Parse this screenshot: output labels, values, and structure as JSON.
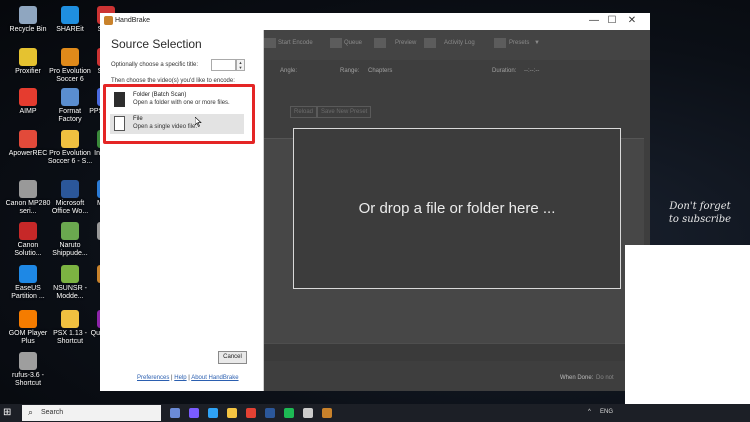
{
  "desktop_icons": [
    {
      "label": "Recycle Bin",
      "color": "#8fa6c0"
    },
    {
      "label": "SHAREit",
      "color": "#1f8fe0"
    },
    {
      "label": "Strea",
      "color": "#c33"
    },
    {
      "label": "Proxifier",
      "color": "#e5c230"
    },
    {
      "label": "Pro Evolution Soccer 6",
      "color": "#e08a1a"
    },
    {
      "label": "Strea",
      "color": "#c33"
    },
    {
      "label": "AIMP",
      "color": "#e53c2f"
    },
    {
      "label": "Format Factory",
      "color": "#5a8ed0"
    },
    {
      "label": "PPSS - Sh",
      "color": "#4a6ae0"
    },
    {
      "label": "ApowerREC",
      "color": "#e24a3a"
    },
    {
      "label": "Pro Evolution Soccer 6 - S...",
      "color": "#f0c040"
    },
    {
      "label": "Int Dow",
      "color": "#3a8a3a"
    },
    {
      "label": "Canon MP280 seri...",
      "color": "#999999"
    },
    {
      "label": "Microsoft Office Wo...",
      "color": "#2b579a"
    },
    {
      "label": "Mi Ed",
      "color": "#2b7bd6"
    },
    {
      "label": "Canon Solutio...",
      "color": "#c62828"
    },
    {
      "label": "Naruto Shippude...",
      "color": "#6aa84f"
    },
    {
      "label": "SM",
      "color": "#999999"
    },
    {
      "label": "EaseUS Partition ...",
      "color": "#1e88e5"
    },
    {
      "label": "NSUNSR - Modde...",
      "color": "#7cb342"
    },
    {
      "label": "Han",
      "color": "#c9822b"
    },
    {
      "label": "GOM Player Plus",
      "color": "#f57c00"
    },
    {
      "label": "PSX 1.13 - Shortcut",
      "color": "#f0c040"
    },
    {
      "label": "Quick Net",
      "color": "#8e24aa"
    },
    {
      "label": "rufus-3.6 - Shortcut",
      "color": "#9e9e9e"
    }
  ],
  "watermark": {
    "line1": "Don't forget",
    "line2": "to subscribe"
  },
  "window": {
    "title": "HandBrake",
    "minimize": "—",
    "maximize": "☐",
    "close": "✕"
  },
  "toolbar": {
    "start_encode": "Start Encode",
    "queue": "Queue",
    "preview": "Preview",
    "activity_log": "Activity Log",
    "presets": "Presets"
  },
  "source_row": {
    "angle": "Angle:",
    "range": "Range:",
    "range_value": "Chapters",
    "duration": "Duration:",
    "duration_value": "--:--:--"
  },
  "preset_buttons": {
    "reload": "Reload",
    "save_new_preset": "Save New Preset"
  },
  "drop_zone": {
    "text": "Or drop a file or folder here ..."
  },
  "status": {
    "when_done_label": "When Done:",
    "when_done_value": "Do not"
  },
  "source_panel": {
    "title": "Source Selection",
    "optional_title_label": "Optionally choose a specific title:",
    "title_value": "",
    "choose_label": "Then choose the video(s) you'd like to encode:",
    "folder": {
      "title": "Folder (Batch Scan)",
      "desc": "Open a folder with one or more files."
    },
    "file": {
      "title": "File",
      "desc": "Open a single video file."
    },
    "cancel": "Cancel",
    "links": {
      "preferences": "Preferences",
      "help": "Help",
      "about": "About HandBrake",
      "sep": "|"
    }
  },
  "taskbar": {
    "search_placeholder": "Search",
    "tray_language": "ENG",
    "tray_time": "",
    "apps": [
      {
        "name": "task-view",
        "color": "#6b8bd6"
      },
      {
        "name": "app-1",
        "color": "#7a5cff"
      },
      {
        "name": "photoshop",
        "color": "#2fa3f7"
      },
      {
        "name": "file-explorer",
        "color": "#f5c542"
      },
      {
        "name": "chrome",
        "color": "#e34133"
      },
      {
        "name": "word",
        "color": "#2b579a"
      },
      {
        "name": "spotify",
        "color": "#1db954"
      },
      {
        "name": "app-2",
        "color": "#cccccc"
      },
      {
        "name": "handbrake",
        "color": "#c9822b"
      }
    ]
  },
  "highlight_color": "#e42525"
}
